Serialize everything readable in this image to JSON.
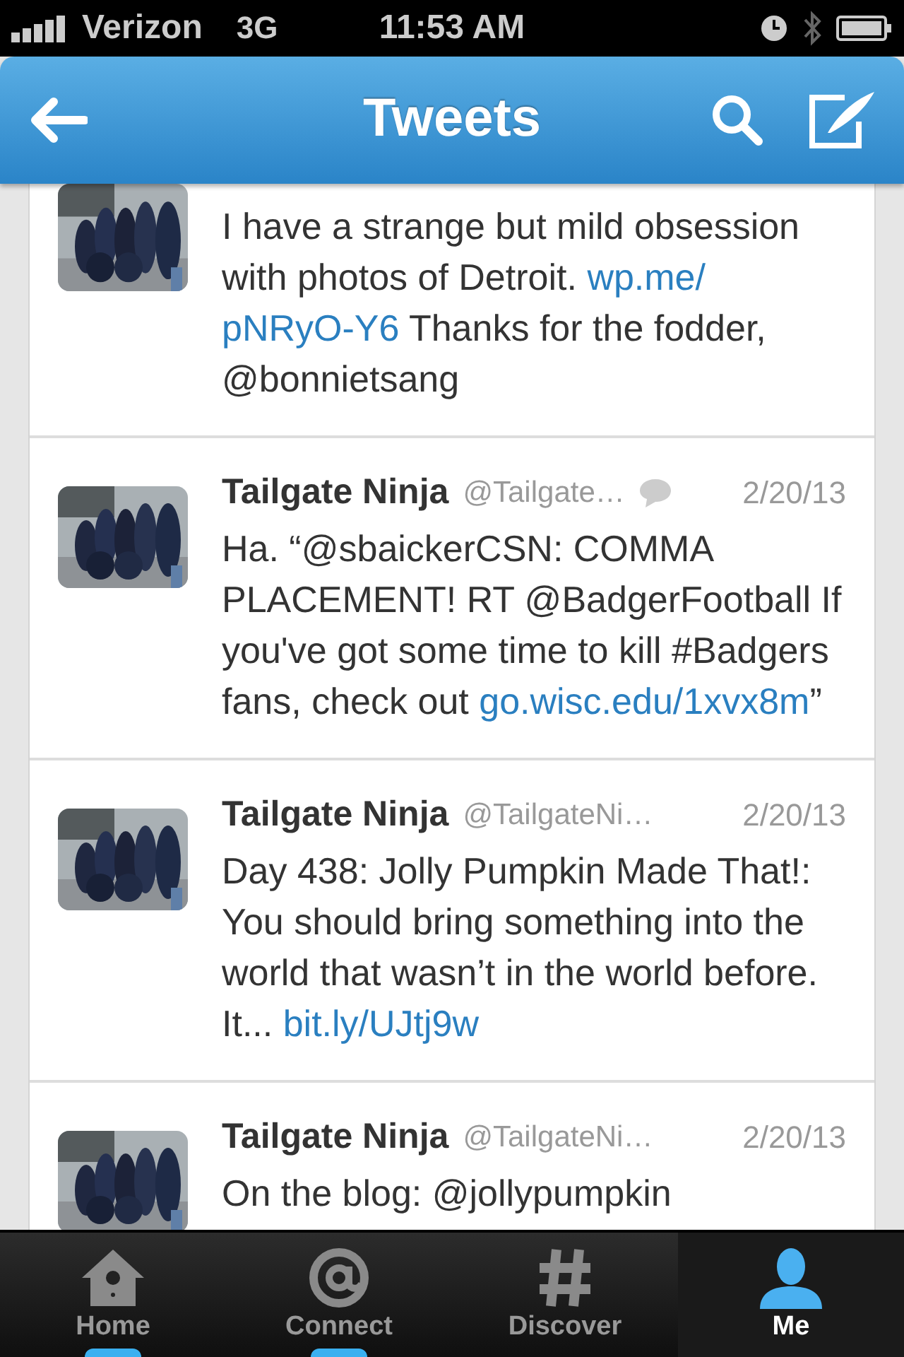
{
  "status_bar": {
    "carrier": "Verizon",
    "network": "3G",
    "time": "11:53 AM"
  },
  "nav": {
    "title": "Tweets"
  },
  "tweets": [
    {
      "body": [
        {
          "text": "I have a strange but mild obsession with photos of Detroit. ",
          "link": false
        },
        {
          "text": "wp.me/",
          "link": true
        },
        {
          "text": "pNRyO-Y6",
          "link": true
        },
        {
          "text": " Thanks for the fodder, @bonnietsang",
          "link": false
        }
      ]
    },
    {
      "name": "Tailgate Ninja",
      "handle": "@Tailgate…",
      "date": "2/20/13",
      "reply": true,
      "body": [
        {
          "text": "Ha. “@sbaickerCSN: COMMA PLACEMENT! RT @BadgerFootball If you've got some time to kill #Badgers fans, check out ",
          "link": false
        },
        {
          "text": "go.wisc.edu/1xvx8m",
          "link": true
        },
        {
          "text": "”",
          "link": false
        }
      ]
    },
    {
      "name": "Tailgate Ninja",
      "handle": "@TailgateNi…",
      "date": "2/20/13",
      "reply": false,
      "body": [
        {
          "text": "Day 438: Jolly Pumpkin Made That!: You should bring something into the world that wasn’t in the world before. It... ",
          "link": false
        },
        {
          "text": "bit.ly/UJtj9w",
          "link": true
        }
      ]
    },
    {
      "name": "Tailgate Ninja",
      "handle": "@TailgateNi…",
      "date": "2/20/13",
      "reply": false,
      "body": [
        {
          "text": "On the blog: @jollypumpkin",
          "link": false
        }
      ]
    }
  ],
  "tabs": [
    {
      "label": "Home",
      "selected": false,
      "unread": true
    },
    {
      "label": "Connect",
      "selected": false,
      "unread": true
    },
    {
      "label": "Discover",
      "selected": false,
      "unread": false
    },
    {
      "label": "Me",
      "selected": true,
      "unread": false
    }
  ]
}
